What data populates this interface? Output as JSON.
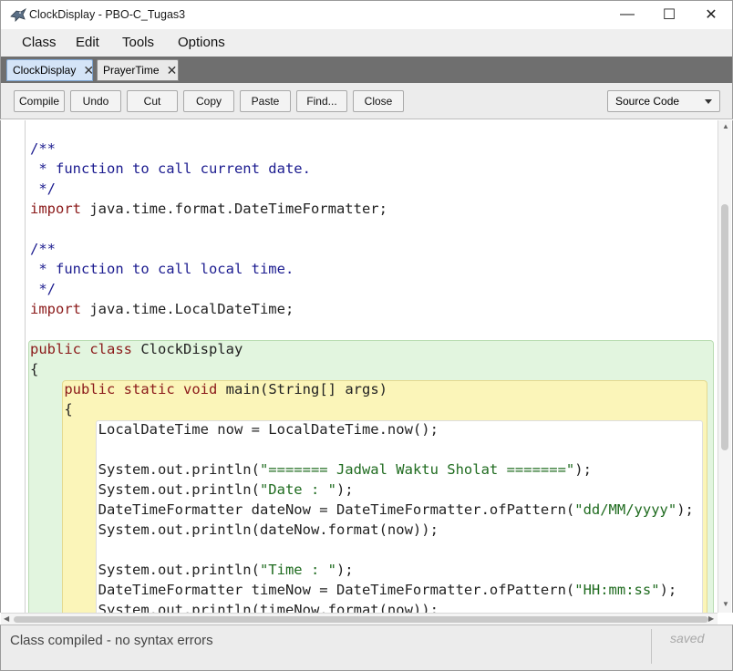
{
  "window": {
    "title": "ClockDisplay - PBO-C_Tugas3",
    "minimize_glyph": "—",
    "maximize_glyph": "☐",
    "close_glyph": "✕",
    "app_icon": "bluej-bird-icon"
  },
  "menu": {
    "items": [
      "Class",
      "Edit",
      "Tools",
      "Options"
    ]
  },
  "tabs": [
    {
      "label": "ClockDisplay",
      "active": true,
      "close": "✕"
    },
    {
      "label": "PrayerTime",
      "active": false,
      "close": "✕"
    }
  ],
  "toolbar": {
    "buttons": [
      "Compile",
      "Undo",
      "Cut",
      "Copy",
      "Paste",
      "Find...",
      "Close"
    ],
    "view_select": "Source Code"
  },
  "code": {
    "lines": [
      "/**",
      " * function to call current date.",
      " */",
      "import java.time.format.DateTimeFormatter;",
      "",
      "/**",
      " * function to call local time.",
      " */",
      "import java.time.LocalDateTime;",
      "",
      "public class ClockDisplay",
      "{",
      "    public static void main(String[] args)",
      "    {",
      "        LocalDateTime now = LocalDateTime.now();",
      "",
      "        System.out.println(\"======= Jadwal Waktu Sholat =======\");",
      "        System.out.println(\"Date : \");",
      "        DateTimeFormatter dateNow = DateTimeFormatter.ofPattern(\"dd/MM/yyyy\");",
      "        System.out.println(dateNow.format(now));",
      "",
      "        System.out.println(\"Time : \");",
      "        DateTimeFormatter timeNow = DateTimeFormatter.ofPattern(\"HH:mm:ss\");",
      "        System.out.println(timeNow.format(now));"
    ]
  },
  "status": {
    "message": "Class compiled - no syntax errors",
    "saved": "saved"
  },
  "colors": {
    "comment": "#1b1b8f",
    "keyword": "#8b1a1a",
    "string": "#1f6b1f",
    "class_scope": "#e2f5df",
    "method_scope": "#fbf5b9",
    "active_tab": "#d4e4f7"
  }
}
